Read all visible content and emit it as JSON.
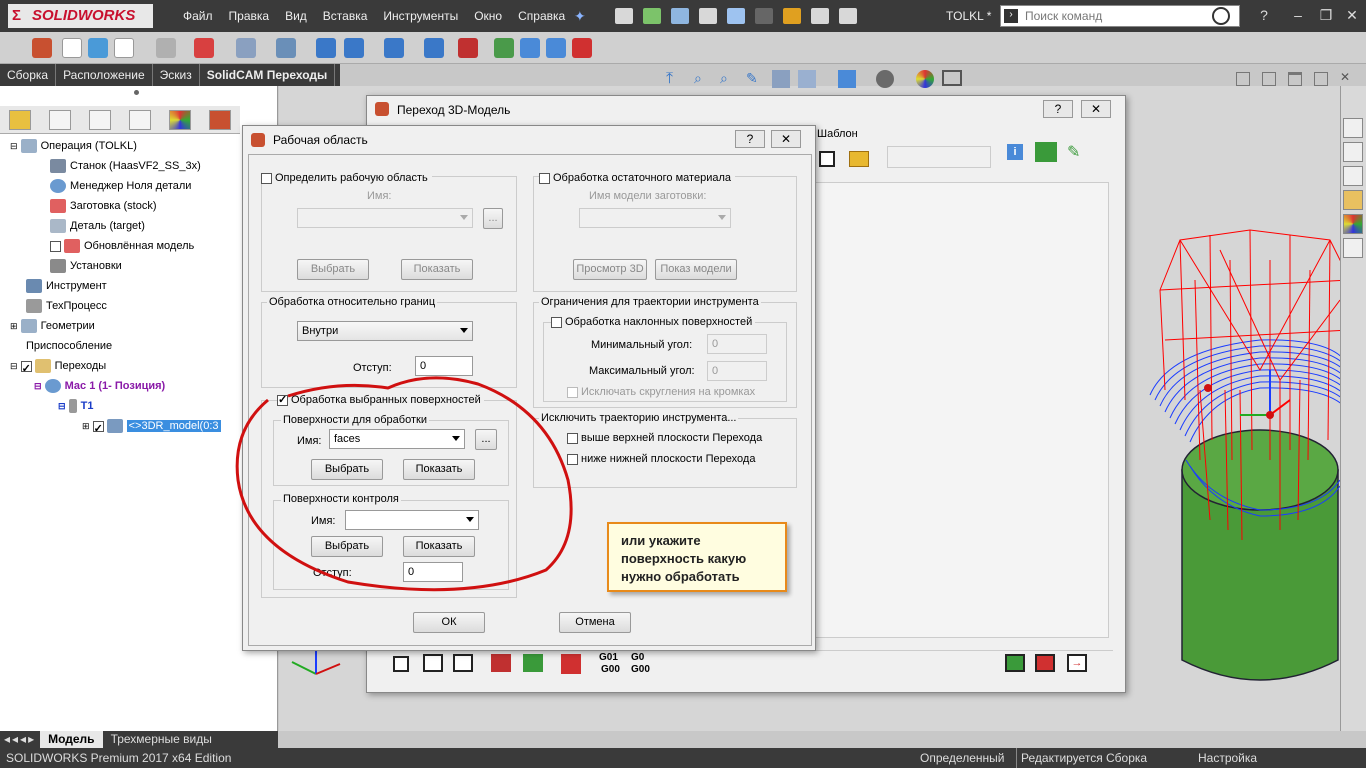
{
  "app": {
    "logo_text": "SOLIDWORKS",
    "menu": [
      "Файл",
      "Правка",
      "Вид",
      "Вставка",
      "Инструменты",
      "Окно",
      "Справка"
    ],
    "doc_name": "TOLKL *",
    "search_placeholder": "Поиск команд"
  },
  "cmd_tabs": [
    "Сборка",
    "Расположение",
    "Эскиз",
    "SolidCAM Переходы"
  ],
  "tree": {
    "items": [
      {
        "label": "Операция (TOLKL)",
        "icon": "operation-icon"
      },
      {
        "label": "Станок (HaasVF2_SS_3x)",
        "icon": "machine-icon"
      },
      {
        "label": "Менеджер Ноля детали",
        "icon": "coordinate-icon"
      },
      {
        "label": "Заготовка (stock)",
        "icon": "stock-icon"
      },
      {
        "label": "Деталь (target)",
        "icon": "target-icon"
      },
      {
        "label": "Обновлённая модель",
        "icon": "model-icon"
      },
      {
        "label": "Установки",
        "icon": "settings-icon"
      },
      {
        "label": "Инструмент",
        "icon": "tool-icon"
      },
      {
        "label": "ТехПроцесс",
        "icon": "process-icon"
      },
      {
        "label": "Геометрии",
        "icon": "geometry-icon"
      },
      {
        "label": "Приспособление",
        "icon": "fixture-icon"
      },
      {
        "label": "Переходы",
        "icon": "operations-folder-icon"
      },
      {
        "label": "Мас 1 (1- Позиция)",
        "icon": "mac-icon"
      },
      {
        "label": "T1",
        "icon": "tool-icon"
      },
      {
        "label": "<>3DR_model(0:3",
        "icon": "3d-model-icon"
      }
    ]
  },
  "bottom_tabs": [
    "Модель",
    "Трехмерные виды"
  ],
  "status": {
    "edition": "SOLIDWORKS Premium 2017 x64 Edition",
    "defined": "Определенный",
    "editing": "Редактируется Сборка",
    "settings": "Настройка"
  },
  "op_dialog": {
    "title": "Переход 3D-Модель",
    "template_label": "Шаблон",
    "help": "?",
    "close": "✕",
    "g01_a": "G01",
    "g00_a": "G00",
    "g01_b": "G0",
    "g00_b": "G00"
  },
  "wa_dialog": {
    "title": "Рабочая область",
    "help": "?",
    "close": "✕",
    "define_workarea": "Определить рабочую область",
    "name_label": "Имя:",
    "select": "Выбрать",
    "show": "Показать",
    "ellipsis": "...",
    "rest_material": "Обработка остаточного материала",
    "stock_model_name": "Имя модели заготовки:",
    "preview3d": "Просмотр 3D",
    "show_model": "Показ модели",
    "boundary_group": "Обработка относительно границ",
    "boundary_value": "Внутри",
    "offset_label": "Отступ:",
    "offset_value": "0",
    "tool_limits_group": "Ограничения для траектории инструмента",
    "slope_surfaces": "Обработка наклонных поверхностей",
    "min_angle": "Минимальный угол:",
    "min_angle_value": "0",
    "max_angle": "Максимальный угол:",
    "max_angle_value": "0",
    "exclude_fillets": "Исключать скругления на кромках",
    "selected_faces": "Обработка выбранных поверхностей",
    "drive_group": "Поверхности для обработки",
    "drive_name": "faces",
    "check_group": "Поверхности контроля",
    "check_offset_value": "0",
    "exclude_group": "Исключить траекторию инструмента...",
    "above_top": "выше верхней плоскости Перехода",
    "below_bottom": "ниже нижней плоскости Перехода",
    "ok": "ОК",
    "cancel": "Отмена"
  },
  "callout": {
    "line1": "или укажите",
    "line2": "поверхность какую",
    "line3": "нужно обработать"
  },
  "colors": {
    "annotation": "#d01010",
    "toolpath_red": "#ff0000",
    "toolpath_blue": "#1a3cff",
    "model_green": "#3e8a2a"
  }
}
